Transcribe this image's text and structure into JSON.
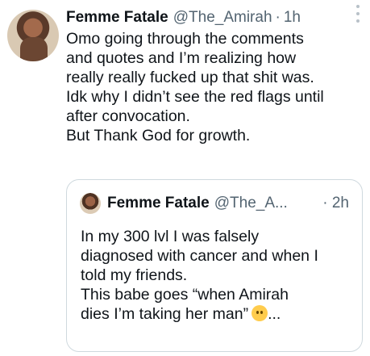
{
  "tweet": {
    "name": "Femme Fatale",
    "handle": "@The_Amirah",
    "separator": "·",
    "time": "1h",
    "text": "Omo going through the comments\nand quotes and I’m realizing how\nreally really fucked up that shit was.\nIdk why I didn’t see the red flags until\nafter convocation.\nBut Thank God for growth."
  },
  "quoted_tweet": {
    "name": "Femme Fatale",
    "handle": "@The_A...",
    "time": "· 2h",
    "text": "In my 300 lvl I was falsely\ndiagnosed with cancer and when I\ntold my friends.\nThis babe goes “when Amirah\ndies I’m taking her man”",
    "emoji": "upside-down-face-emoji",
    "ellipsis": "..."
  },
  "colors": {
    "text": "#0f1419",
    "secondary": "#536471",
    "border": "#cfd9de"
  }
}
